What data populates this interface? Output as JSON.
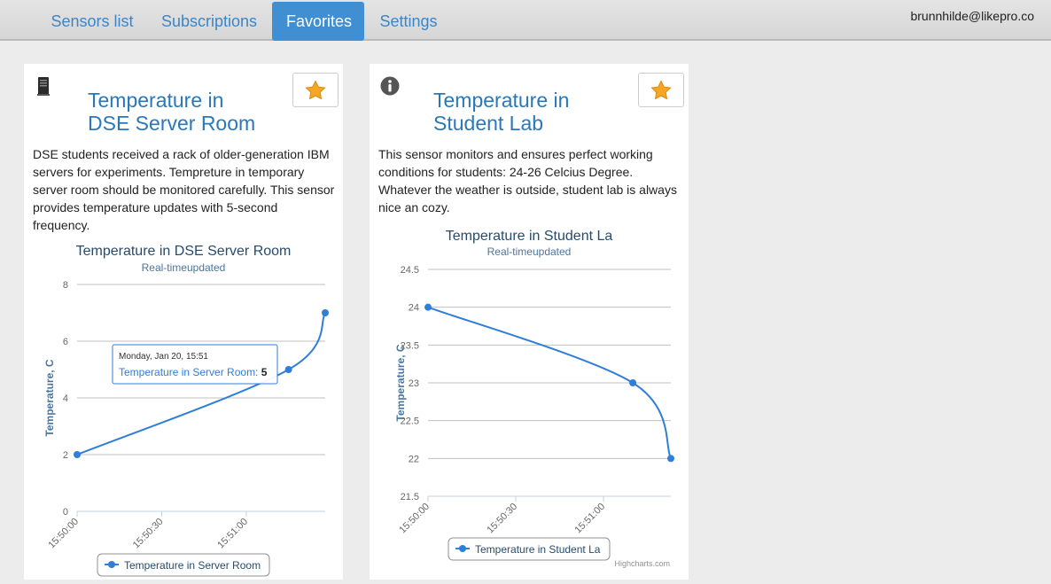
{
  "nav": {
    "tabs": [
      {
        "label": "Sensors list",
        "active": false
      },
      {
        "label": "Subscriptions",
        "active": false
      },
      {
        "label": "Favorites",
        "active": true
      },
      {
        "label": "Settings",
        "active": false
      }
    ],
    "user_email": "brunnhilde@likepro.co"
  },
  "colors": {
    "accent": "#3f8fd2",
    "link": "#2a77ba",
    "series": "#2f7ed8",
    "star": "#f5a623"
  },
  "cards": [
    {
      "icon": "server-icon",
      "title_line1": "Temperature in",
      "title_line2": "DSE Server Room",
      "description": "DSE students received a rack of older-generation IBM servers for experiments. Tempreture in temporary server room should be monitored carefully. This sensor provides temperature updates with 5-second frequency.",
      "favorite_icon": "star-icon"
    },
    {
      "icon": "info-icon",
      "title_line1": "Temperature in",
      "title_line2": "Student Lab",
      "description": "This sensor monitors and ensures perfect working conditions for students: 24-26 Celcius Degree. Whatever the weather is outside, student lab is always nice an cozy.",
      "favorite_icon": "star-icon"
    }
  ],
  "chart_data": [
    {
      "type": "line",
      "title": "Temperature in DSE Server Room",
      "subtitle": "Real-timeupdated",
      "ylabel": "Temperature, C",
      "ylim": [
        0,
        8
      ],
      "yticks": [
        0,
        2,
        4,
        6,
        8
      ],
      "xlim_seconds": [
        0,
        75
      ],
      "xticks": [
        {
          "t": 0,
          "label": "15:50:00"
        },
        {
          "t": 30,
          "label": "15:50:30"
        },
        {
          "t": 60,
          "label": "15:51:00"
        }
      ],
      "series": [
        {
          "name": "Temperature in Server Room",
          "points": [
            {
              "t": 0,
              "label": "15:50:00",
              "y": 2
            },
            {
              "t": 75,
              "label": "15:51:15",
              "y": 5
            },
            {
              "t": 88,
              "label": "15:51:28",
              "y": 7
            }
          ]
        }
      ],
      "tooltip": {
        "header": "Monday, Jan 20, 15:51",
        "series": "Temperature in Server Room",
        "value": "5"
      },
      "legend": "bottom-center",
      "grid": true
    },
    {
      "type": "line",
      "title": "Temperature in Student La",
      "subtitle": "Real-timeupdated",
      "ylabel": "Temperature, C",
      "ylim": [
        21.5,
        24.5
      ],
      "yticks": [
        21.5,
        22,
        22.5,
        23,
        23.5,
        24,
        24.5
      ],
      "xlim_seconds": [
        0,
        83
      ],
      "xticks": [
        {
          "t": 0,
          "label": "15:50:00"
        },
        {
          "t": 30,
          "label": "15:50:30"
        },
        {
          "t": 60,
          "label": "15:51:00"
        }
      ],
      "series": [
        {
          "name": "Temperature in Student La",
          "points": [
            {
              "t": 0,
              "label": "15:50:00",
              "y": 24
            },
            {
              "t": 70,
              "label": "15:51:10",
              "y": 23
            },
            {
              "t": 83,
              "label": "15:51:23",
              "y": 22
            }
          ]
        }
      ],
      "credits": "Highcharts.com",
      "legend": "bottom-center",
      "grid": true
    }
  ]
}
